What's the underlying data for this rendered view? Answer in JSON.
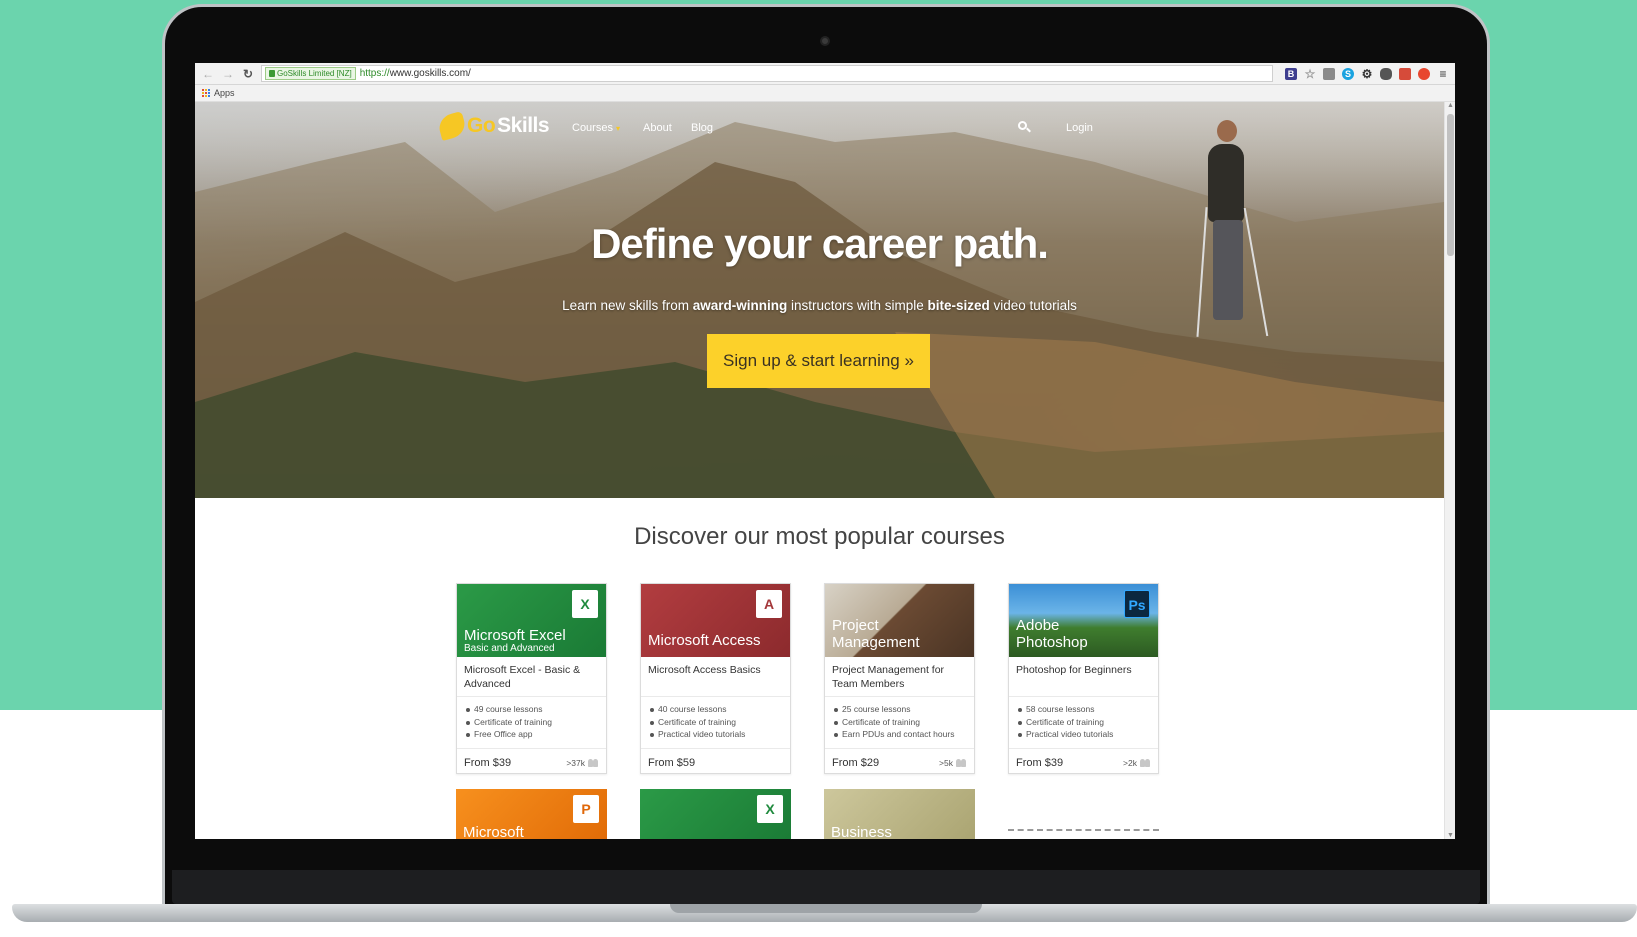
{
  "browser": {
    "secure_label": "GoSkills Limited [NZ]",
    "url_scheme": "https://",
    "url_rest": "www.goskills.com/",
    "bookmark_apps": "Apps"
  },
  "nav": {
    "logo_go": "Go",
    "logo_skills": "Skills",
    "courses": "Courses",
    "about": "About",
    "blog": "Blog",
    "login": "Login"
  },
  "hero": {
    "title": "Define your career path.",
    "subtitle_pre": "Learn new skills from ",
    "subtitle_b1": "award-winning",
    "subtitle_mid": " instructors with simple ",
    "subtitle_b2": "bite-sized",
    "subtitle_post": " video tutorials",
    "cta": "Sign up & start learning »"
  },
  "courses": {
    "heading": "Discover our most popular courses",
    "cards": [
      {
        "banner": "Microsoft Excel",
        "banner_sub": "Basic and Advanced",
        "badge": "X",
        "name": "Microsoft Excel - Basic & Advanced",
        "features": [
          "49 course lessons",
          "Certificate of training",
          "Free Office app"
        ],
        "price": "From $39",
        "enrolled": ">37k"
      },
      {
        "banner": "Microsoft Access",
        "banner_sub": "",
        "badge": "A",
        "name": "Microsoft Access Basics",
        "features": [
          "40 course lessons",
          "Certificate of training",
          "Practical video tutorials"
        ],
        "price": "From $59",
        "enrolled": ""
      },
      {
        "banner": "Project Management",
        "banner_sub": "",
        "badge": "",
        "name": "Project Management for Team Members",
        "features": [
          "25 course lessons",
          "Certificate of training",
          "Earn PDUs and contact hours"
        ],
        "price": "From $29",
        "enrolled": ">5k"
      },
      {
        "banner": "Adobe Photoshop",
        "banner_sub": "",
        "badge": "Ps",
        "name": "Photoshop for Beginners",
        "features": [
          "58 course lessons",
          "Certificate of training",
          "Practical video tutorials"
        ],
        "price": "From $39",
        "enrolled": ">2k"
      }
    ],
    "next_row": [
      "Microsoft",
      "",
      "Business"
    ]
  },
  "colors": {
    "background": "#6bd4ad",
    "cta": "#fcd12a",
    "excel": "#1f8a3d",
    "access": "#a4373a",
    "powerpoint": "#f57c0a",
    "brand_yellow": "#f6c724"
  }
}
